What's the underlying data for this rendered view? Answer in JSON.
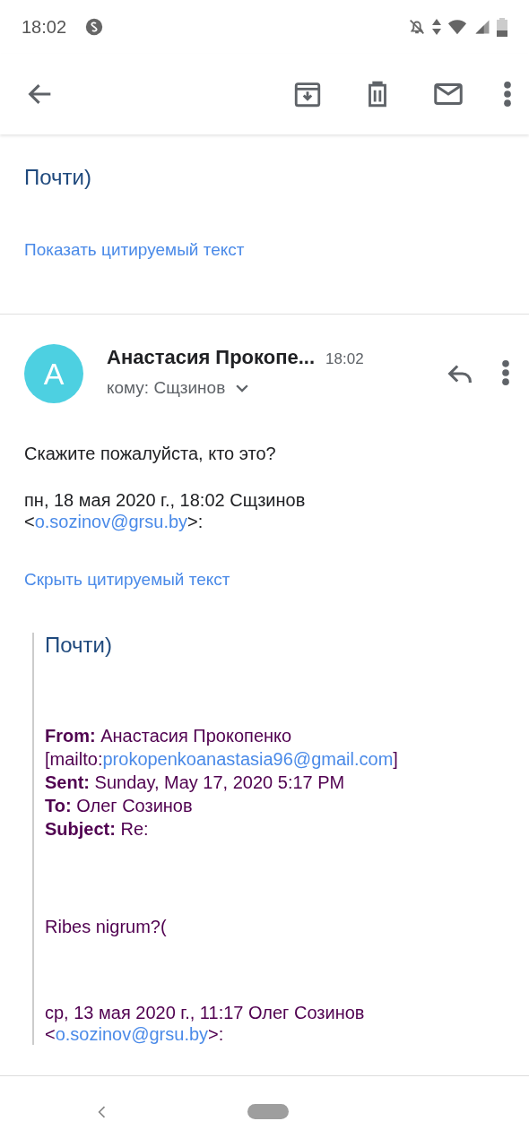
{
  "status_bar": {
    "time": "18:02"
  },
  "earlier_message": {
    "snippet": "Почти)",
    "quote_toggle": "Показать цитируемый текст"
  },
  "message": {
    "avatar_letter": "A",
    "sender": "Анастасия Прокопе...",
    "time": "18:02",
    "recipient": "кому: Сщзинов",
    "body": "Скажите пожалуйста, кто это?",
    "attribution": {
      "text": "пн, 18 мая 2020 г., 18:02 Сщзинов",
      "before": "<",
      "link": "o.sozinov@grsu.by",
      "after": ">:"
    },
    "quote_toggle": "Скрыть цитируемый текст",
    "quote": {
      "snippet": "Почти)",
      "headers": [
        {
          "text": "**From:** Анастасия Прокопенко",
          "before": "[mailto:",
          "link": "prokopenkoanastasia96@gmail.com",
          "after": "]"
        },
        {
          "text": "**Sent:** Sunday, May 17, 2020 5:17 PM"
        },
        {
          "text": "**To:** Олег Созинов"
        },
        {
          "text": "**Subject:** Re:"
        }
      ],
      "body": "Ribes nigrum?(",
      "attribution": {
        "text": "ср, 13 мая 2020 г., 11:17 Олег Созинов",
        "before": "<",
        "link": "o.sozinov@grsu.by",
        "after": ">:"
      }
    }
  }
}
